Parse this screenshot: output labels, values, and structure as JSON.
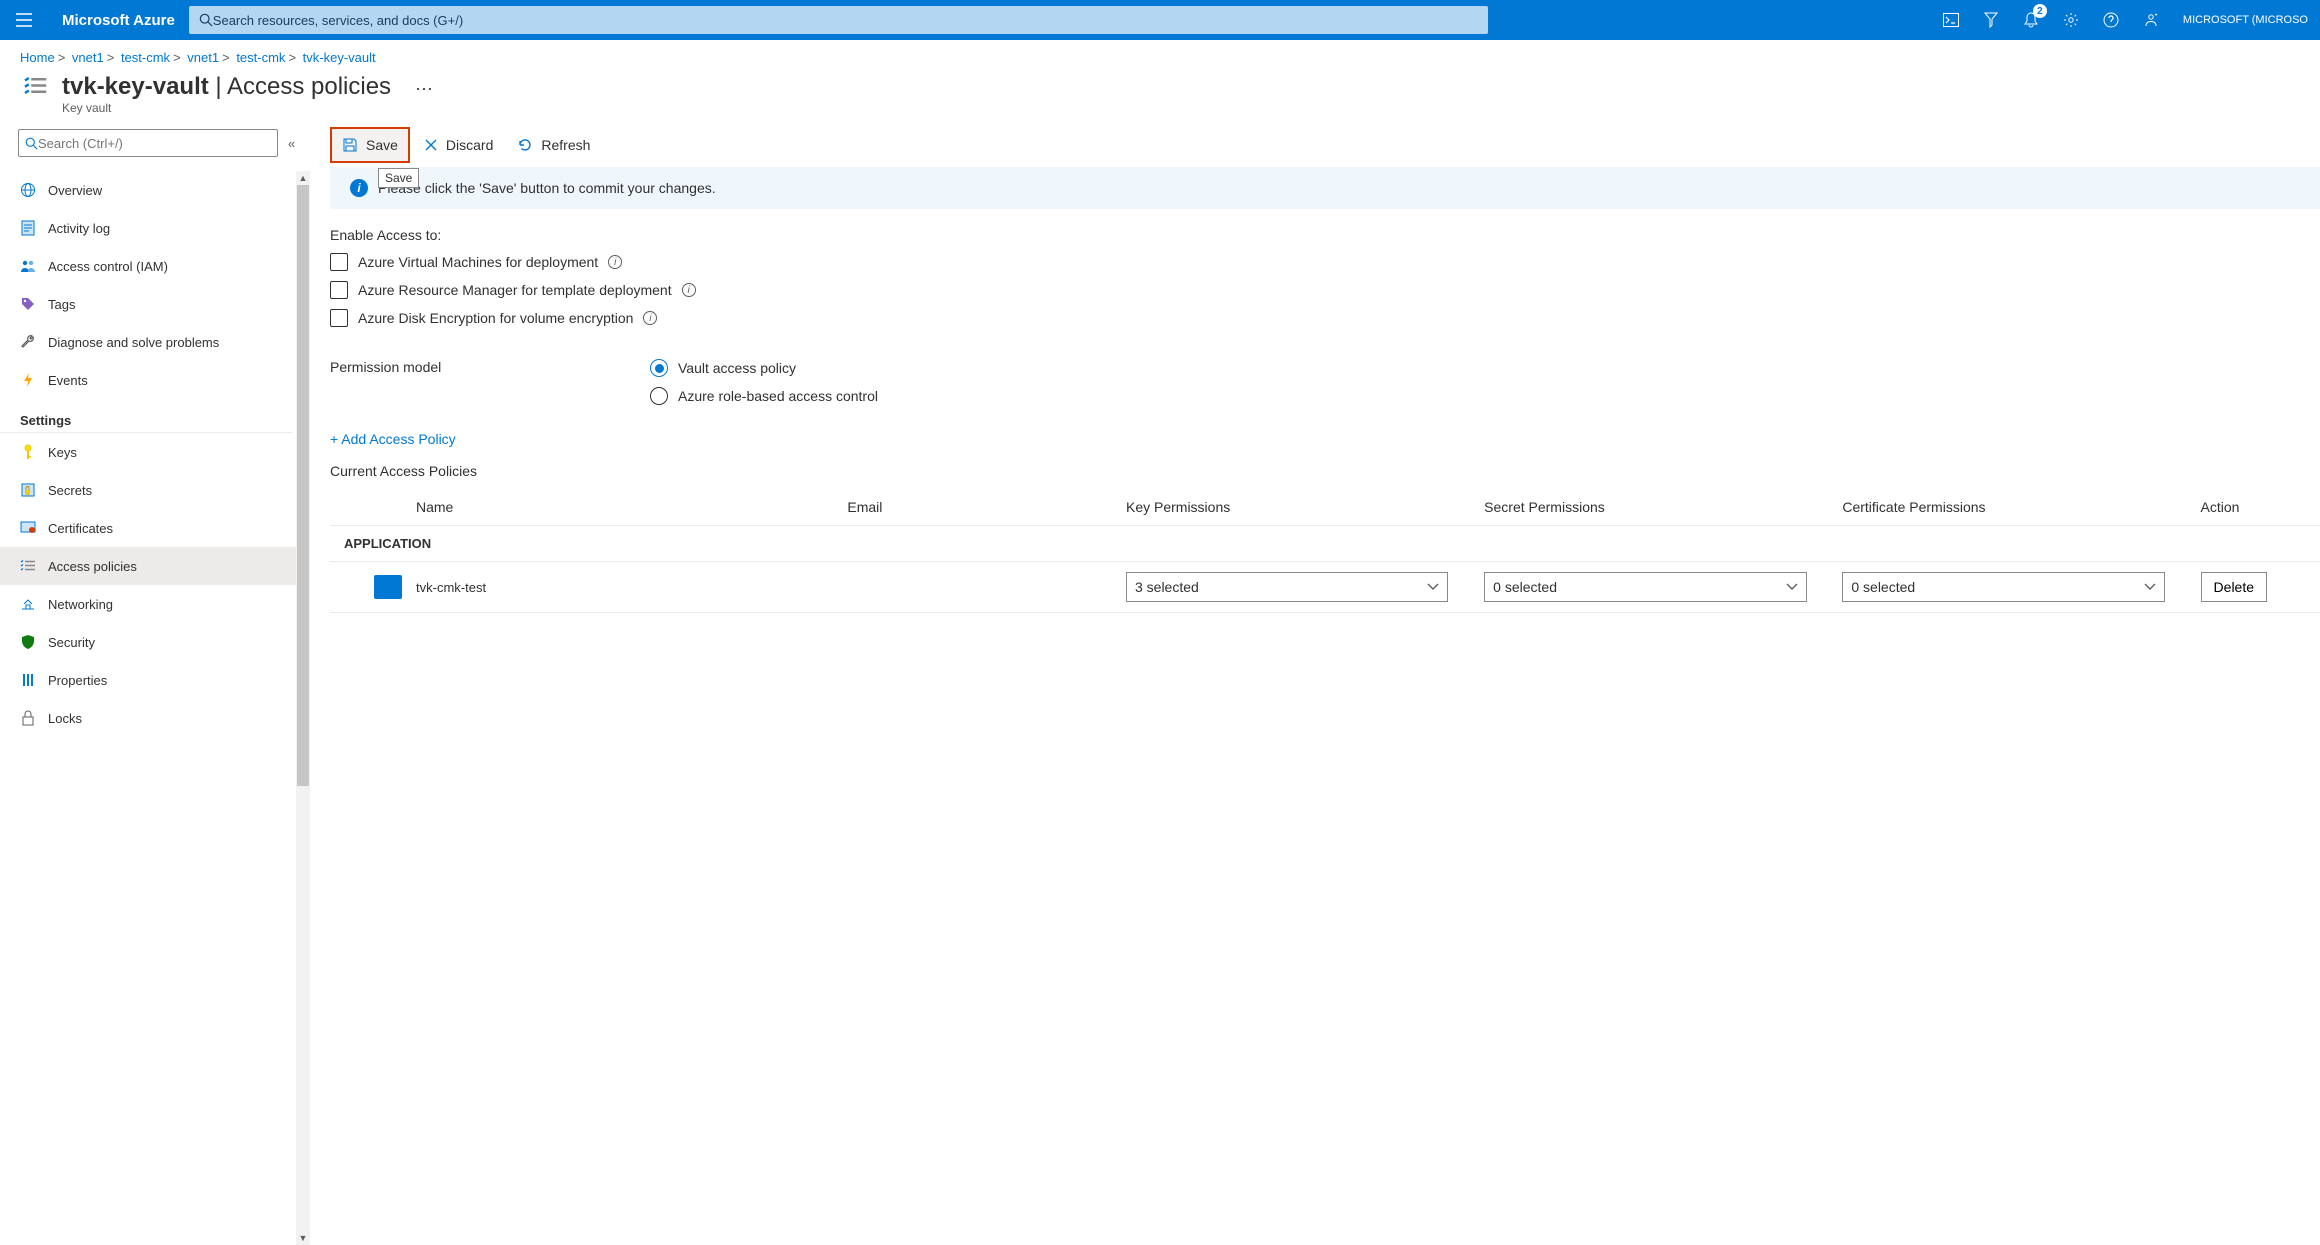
{
  "topbar": {
    "brand": "Microsoft Azure",
    "search_placeholder": "Search resources, services, and docs (G+/)",
    "notif_count": "2",
    "tenant": "MICROSOFT (MICROSO"
  },
  "breadcrumb": [
    "Home",
    "vnet1",
    "test-cmk",
    "vnet1",
    "test-cmk",
    "tvk-key-vault"
  ],
  "page": {
    "title": "tvk-key-vault",
    "section": "Access policies",
    "subtitle": "Key vault"
  },
  "sidebar": {
    "search_placeholder": "Search (Ctrl+/)",
    "items": [
      {
        "label": "Overview",
        "icon": "globe"
      },
      {
        "label": "Activity log",
        "icon": "log"
      },
      {
        "label": "Access control (IAM)",
        "icon": "iam"
      },
      {
        "label": "Tags",
        "icon": "tag"
      },
      {
        "label": "Diagnose and solve problems",
        "icon": "wrench"
      },
      {
        "label": "Events",
        "icon": "bolt"
      }
    ],
    "settings_heading": "Settings",
    "settings": [
      {
        "label": "Keys",
        "icon": "key"
      },
      {
        "label": "Secrets",
        "icon": "secret"
      },
      {
        "label": "Certificates",
        "icon": "cert"
      },
      {
        "label": "Access policies",
        "icon": "policies",
        "selected": true
      },
      {
        "label": "Networking",
        "icon": "network"
      },
      {
        "label": "Security",
        "icon": "shield"
      },
      {
        "label": "Properties",
        "icon": "props"
      },
      {
        "label": "Locks",
        "icon": "lock"
      }
    ]
  },
  "toolbar": {
    "save": "Save",
    "save_tooltip": "Save",
    "discard": "Discard",
    "refresh": "Refresh"
  },
  "info_banner": "Please click the 'Save' button to commit your changes.",
  "access": {
    "heading": "Enable Access to:",
    "opt_vm": "Azure Virtual Machines for deployment",
    "opt_arm": "Azure Resource Manager for template deployment",
    "opt_disk": "Azure Disk Encryption for volume encryption"
  },
  "perm": {
    "label": "Permission model",
    "opt_vault": "Vault access policy",
    "opt_rbac": "Azure role-based access control"
  },
  "add_policy": "+ Add Access Policy",
  "current_heading": "Current Access Policies",
  "table": {
    "col_name": "Name",
    "col_email": "Email",
    "col_kp": "Key Permissions",
    "col_sp": "Secret Permissions",
    "col_cp": "Certificate Permissions",
    "col_act": "Action",
    "group": "APPLICATION",
    "row0": {
      "name": "tvk-cmk-test",
      "kp": "3 selected",
      "sp": "0 selected",
      "cp": "0 selected",
      "del": "Delete"
    }
  }
}
